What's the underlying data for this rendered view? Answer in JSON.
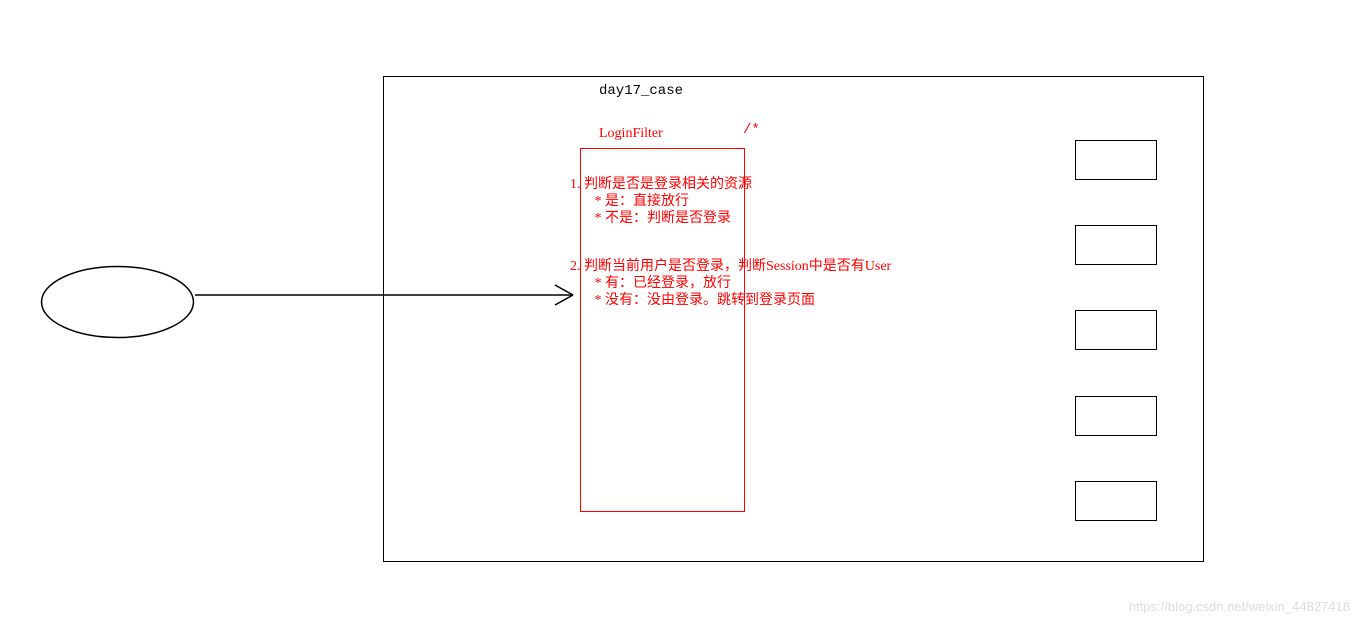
{
  "outer": {
    "title": "day17_case"
  },
  "filter": {
    "title": "LoginFilter",
    "pattern": "/*"
  },
  "steps": {
    "s1_line1": "1. 判断是否是登录相关的资源",
    "s1_line2": "       * 是：直接放行",
    "s1_line3": "       * 不是：判断是否登录",
    "s2_line1": "2. 判断当前用户是否登录，判断Session中是否有User",
    "s2_line2": "       * 有：已经登录，放行",
    "s2_line3": "       * 没有：没由登录。跳转到登录页面"
  },
  "watermark": "https://blog.csdn.net/weixin_44827418"
}
